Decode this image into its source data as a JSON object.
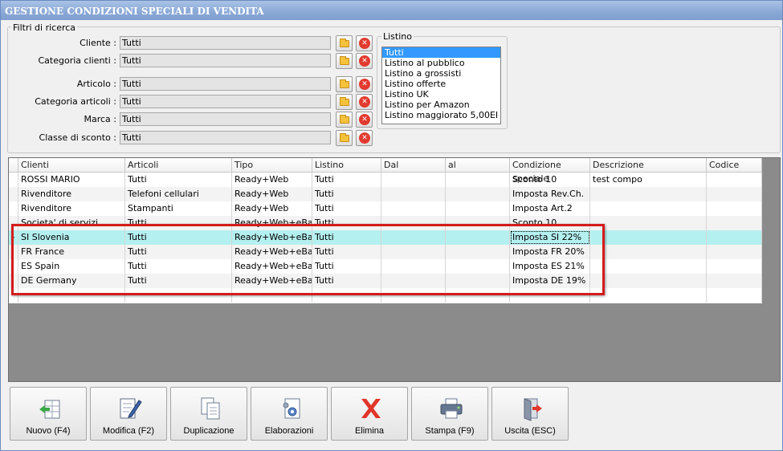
{
  "window": {
    "title": "GESTIONE CONDIZIONI SPECIALI DI VENDITA",
    "minimize": "–",
    "maximize": "□",
    "close": "x"
  },
  "filters": {
    "group_title": "Filtri di ricerca",
    "cliente": {
      "label": "Cliente :",
      "value": "Tutti"
    },
    "categoria_clienti": {
      "label": "Categoria clienti :",
      "value": "Tutti"
    },
    "articolo": {
      "label": "Articolo :",
      "value": "Tutti"
    },
    "categoria_articoli": {
      "label": "Categoria articoli :",
      "value": "Tutti"
    },
    "marca": {
      "label": "Marca :",
      "value": "Tutti"
    },
    "classe_sconto": {
      "label": "Classe di sconto :",
      "value": "Tutti"
    }
  },
  "listino": {
    "group_title": "Listino",
    "items": [
      "Tutti",
      "Listino al pubblico",
      "Listino a grossisti",
      "Listino offerte",
      "Listino UK",
      "Listino per Amazon",
      "Listino maggiorato 5,00EI"
    ],
    "selected": "Tutti"
  },
  "grid": {
    "columns": [
      "Clienti",
      "Articoli",
      "Tipo",
      "Listino",
      "Dal",
      "al",
      "Condizione speciale",
      "Descrizione",
      "Codice"
    ],
    "rows": [
      [
        "ROSSI MARIO",
        "Tutti",
        "Ready+Web",
        "Tutti",
        "",
        "",
        "Sconto 10",
        "test compo",
        ""
      ],
      [
        "Rivenditore",
        "Telefoni cellulari",
        "Ready+Web",
        "Tutti",
        "",
        "",
        "Imposta Rev.Ch.",
        "",
        ""
      ],
      [
        "Rivenditore",
        "Stampanti",
        "Ready+Web",
        "Tutti",
        "",
        "",
        "Imposta Art.2",
        "",
        ""
      ],
      [
        "Societa' di servizi",
        "Tutti",
        "Ready+Web+eBay",
        "Tutti",
        "",
        "",
        "Sconto 10",
        "",
        ""
      ],
      [
        "SI Slovenia",
        "Tutti",
        "Ready+Web+eBay",
        "Tutti",
        "",
        "",
        "Imposta SI 22%",
        "",
        ""
      ],
      [
        "FR France",
        "Tutti",
        "Ready+Web+eBay",
        "Tutti",
        "",
        "",
        "Imposta FR 20%",
        "",
        ""
      ],
      [
        "ES Spain",
        "Tutti",
        "Ready+Web+eBay",
        "Tutti",
        "",
        "",
        "Imposta ES 21%",
        "",
        ""
      ],
      [
        "DE Germany",
        "Tutti",
        "Ready+Web+eBay",
        "Tutti",
        "",
        "",
        "Imposta DE 19%",
        "",
        ""
      ],
      [
        "",
        "",
        "",
        "",
        "",
        "",
        "",
        "",
        ""
      ]
    ],
    "selected_row": 4,
    "row_indicator": "▸"
  },
  "toolbar": {
    "nuovo": "Nuovo (F4)",
    "modifica": "Modifica (F2)",
    "duplicazione": "Duplicazione",
    "elaborazioni": "Elaborazioni",
    "elimina": "Elimina",
    "stampa": "Stampa (F9)",
    "uscita": "Uscita (ESC)"
  },
  "colors": {
    "highlight_row": "#b5f0f0",
    "annotation_box": "#d41c1c",
    "listbox_selection": "#3399ff"
  }
}
